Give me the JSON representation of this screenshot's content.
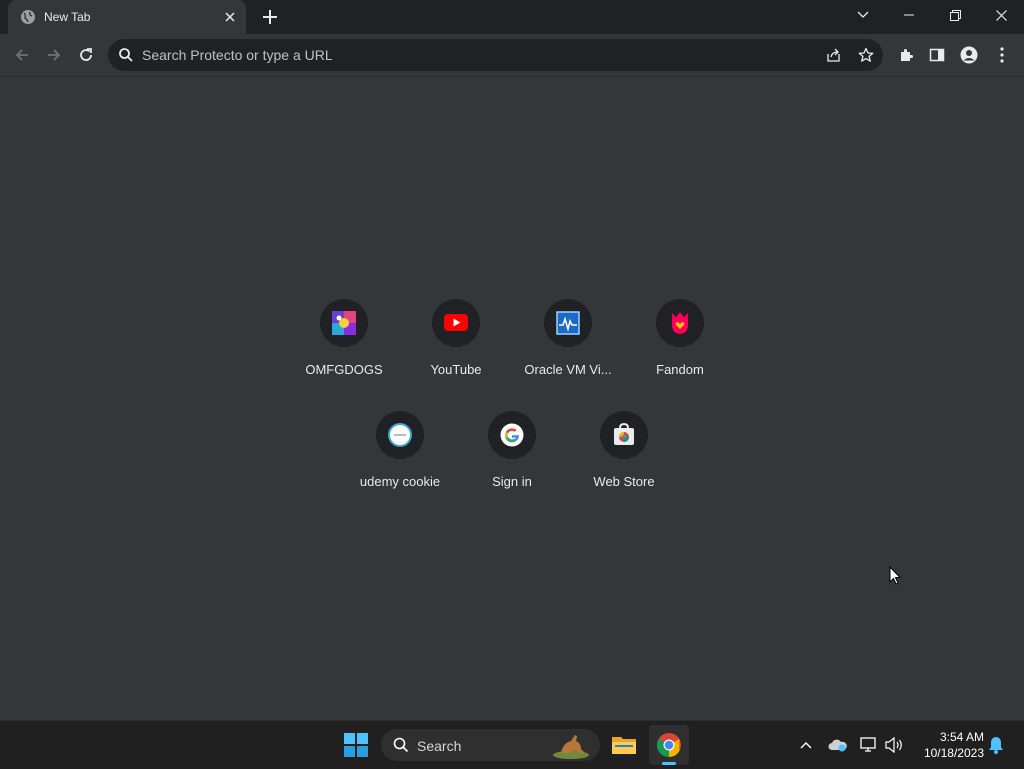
{
  "browser": {
    "tab_title": "New Tab",
    "omnibox_placeholder": "Search Protecto or type a URL"
  },
  "shortcuts": [
    {
      "label": "OMFGDOGS",
      "icon": "omfgdogs-icon"
    },
    {
      "label": "YouTube",
      "icon": "youtube-icon"
    },
    {
      "label": "Oracle VM Vi...",
      "icon": "oracle-vm-icon"
    },
    {
      "label": "Fandom",
      "icon": "fandom-icon"
    },
    {
      "label": "udemy cookie",
      "icon": "udemy-cookie-icon"
    },
    {
      "label": "Sign in",
      "icon": "google-icon"
    },
    {
      "label": "Web Store",
      "icon": "web-store-icon"
    }
  ],
  "taskbar": {
    "search_label": "Search",
    "time": "3:54 AM",
    "date": "10/18/2023"
  },
  "colors": {
    "page_bg": "#35363a",
    "tabstrip_bg": "#202124",
    "taskbar_bg": "#202020",
    "accent": "#4cc2ff"
  }
}
